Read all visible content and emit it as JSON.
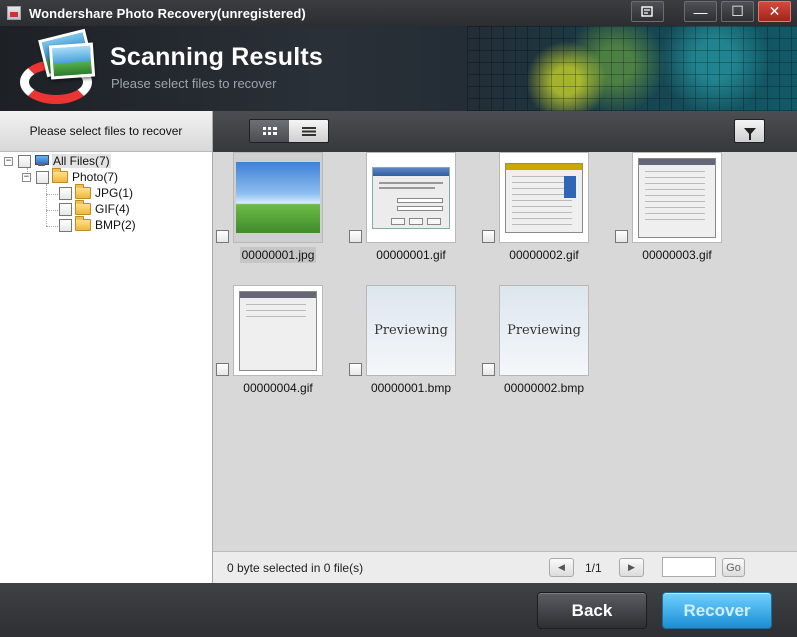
{
  "window": {
    "title": "Wondershare Photo Recovery(unregistered)",
    "controls": {
      "register_icon": "register-icon",
      "minimize": "—",
      "maximize": "☐",
      "close": "✕"
    }
  },
  "banner": {
    "title": "Scanning Results",
    "subtitle": "Please select files to recover"
  },
  "sidebar": {
    "header": "Please select files to recover",
    "tree": {
      "root": {
        "label": "All Files(7)",
        "expander": "−",
        "icon": "computer-icon"
      },
      "photo": {
        "label": "Photo(7)",
        "expander": "−",
        "icon": "folder-icon"
      },
      "children": [
        {
          "label": "JPG(1)",
          "icon": "folder-icon"
        },
        {
          "label": "GIF(4)",
          "icon": "folder-icon"
        },
        {
          "label": "BMP(2)",
          "icon": "folder-icon"
        }
      ]
    }
  },
  "toolbar": {
    "view_modes": [
      "thumbnail-view",
      "list-view"
    ],
    "active_view": "thumbnail-view",
    "filter_icon": "filter-icon"
  },
  "files": [
    {
      "name": "00000001.jpg",
      "preview": "landscape",
      "selected": true
    },
    {
      "name": "00000001.gif",
      "preview": "dialog"
    },
    {
      "name": "00000002.gif",
      "preview": "window"
    },
    {
      "name": "00000003.gif",
      "preview": "window"
    },
    {
      "name": "00000004.gif",
      "preview": "window"
    },
    {
      "name": "00000001.bmp",
      "preview": "text",
      "preview_text": "Previewing"
    },
    {
      "name": "00000002.bmp",
      "preview": "text",
      "preview_text": "Previewing"
    }
  ],
  "status": {
    "selection": "0 byte selected in 0 file(s)",
    "page": "1/1",
    "page_input": "",
    "go_label": "Go",
    "prev_icon": "◀",
    "next_icon": "▶"
  },
  "footer": {
    "back_label": "Back",
    "recover_label": "Recover"
  },
  "colors": {
    "recover_button": "#1b8dd4",
    "background_dark": "#3a3c3f",
    "content_bg": "#d8d8d8"
  }
}
